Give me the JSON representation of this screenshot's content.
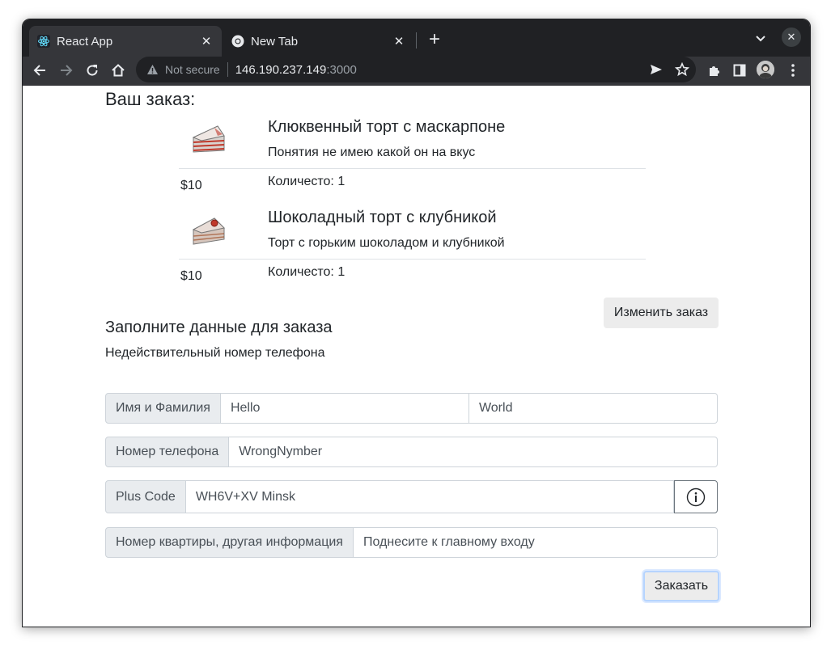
{
  "browser": {
    "tabs": [
      {
        "title": "React App",
        "close": "✕",
        "active": true
      },
      {
        "title": "New Tab",
        "close": "✕",
        "active": false
      }
    ],
    "new_tab": "+",
    "window_close": "✕",
    "omnibox": {
      "security_label": "Not secure",
      "host": "146.190.237.149",
      "port": ":3000"
    }
  },
  "order": {
    "heading": "Ваш заказ:",
    "items": [
      {
        "name": "Клюквенный торт с маскарпоне",
        "description": "Понятия не имею какой он на вкус",
        "quantity": "Количесто: 1",
        "price": "$10",
        "image": "cranberry-cake-icon"
      },
      {
        "name": "Шоколадный торт с клубникой",
        "description": "Торт с горьким шоколадом и клубникой",
        "quantity": "Количесто: 1",
        "price": "$10",
        "image": "chocolate-cake-icon"
      }
    ],
    "change_button": "Изменить заказ"
  },
  "form": {
    "heading": "Заполните данные для заказа",
    "error": "Недействительный номер телефона",
    "name_label": "Имя и Фамилия",
    "first_name": "Hello",
    "last_name": "World",
    "phone_label": "Номер телефона",
    "phone": "WrongNymber",
    "pluscode_label": "Plus Code",
    "pluscode": "WH6V+XV Minsk",
    "apartment_label": "Номер квартиры, другая информация",
    "apartment": "Поднесите к главному входу",
    "submit": "Заказать"
  },
  "colors": {
    "chrome_dark": "#202124",
    "chrome_toolbar": "#35363a",
    "input_group_bg": "#e9ecef",
    "button_bg": "#ececec"
  }
}
